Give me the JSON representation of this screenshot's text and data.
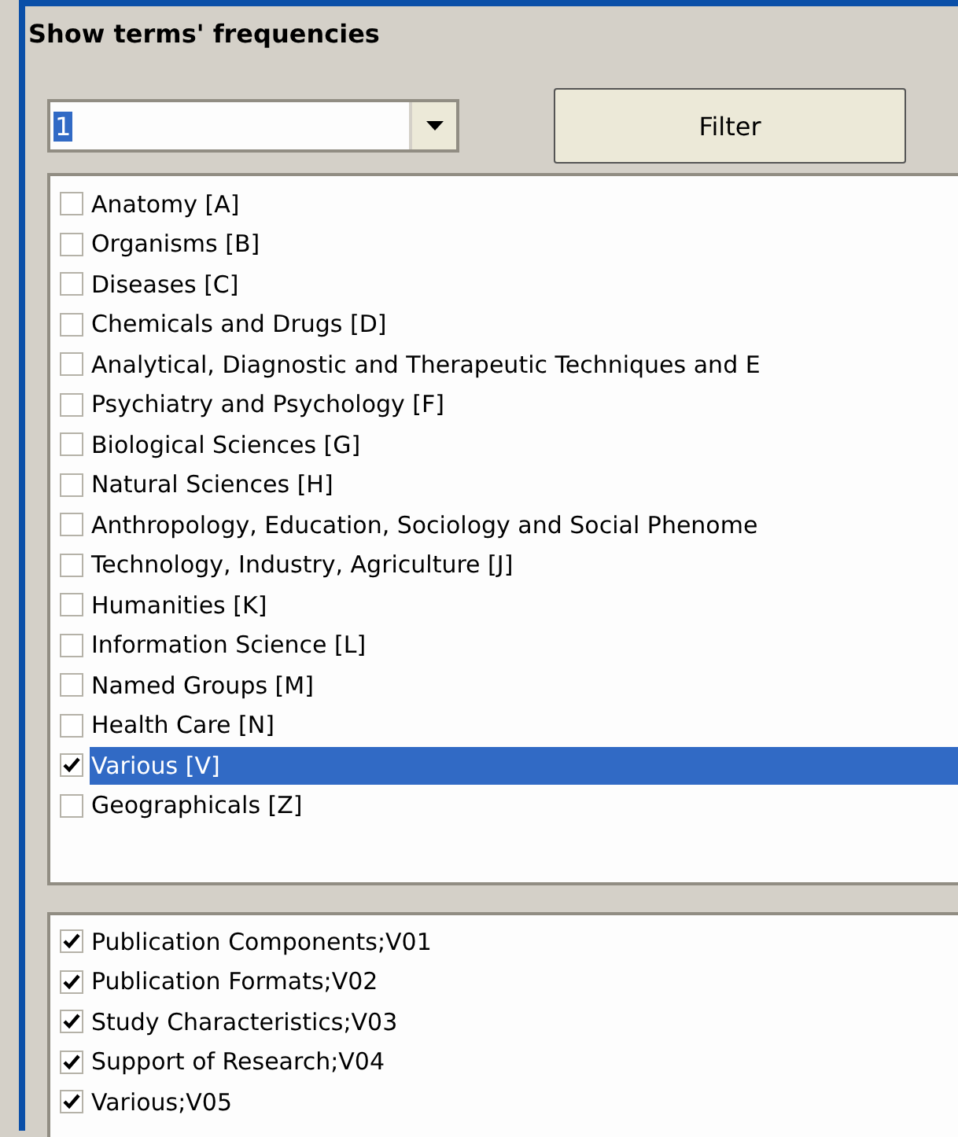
{
  "title": "Show terms' frequencies",
  "combo": {
    "value": "1"
  },
  "filter_button": "Filter",
  "categories": [
    {
      "label": "Anatomy [A]",
      "checked": false,
      "selected": false
    },
    {
      "label": "Organisms [B]",
      "checked": false,
      "selected": false
    },
    {
      "label": "Diseases [C]",
      "checked": false,
      "selected": false
    },
    {
      "label": "Chemicals and Drugs [D]",
      "checked": false,
      "selected": false
    },
    {
      "label": "Analytical, Diagnostic and Therapeutic Techniques and E",
      "checked": false,
      "selected": false
    },
    {
      "label": "Psychiatry and Psychology [F]",
      "checked": false,
      "selected": false
    },
    {
      "label": "Biological Sciences [G]",
      "checked": false,
      "selected": false
    },
    {
      "label": "Natural Sciences [H]",
      "checked": false,
      "selected": false
    },
    {
      "label": "Anthropology, Education, Sociology and Social Phenome",
      "checked": false,
      "selected": false
    },
    {
      "label": "Technology, Industry, Agriculture [J]",
      "checked": false,
      "selected": false
    },
    {
      "label": "Humanities [K]",
      "checked": false,
      "selected": false
    },
    {
      "label": "Information Science [L]",
      "checked": false,
      "selected": false
    },
    {
      "label": "Named Groups [M]",
      "checked": false,
      "selected": false
    },
    {
      "label": "Health Care [N]",
      "checked": false,
      "selected": false
    },
    {
      "label": "Various [V]",
      "checked": true,
      "selected": true
    },
    {
      "label": "Geographicals [Z]",
      "checked": false,
      "selected": false
    }
  ],
  "subcategories": [
    {
      "label": "Publication Components;V01",
      "checked": true
    },
    {
      "label": "Publication Formats;V02",
      "checked": true
    },
    {
      "label": "Study Characteristics;V03",
      "checked": true
    },
    {
      "label": "Support of Research;V04",
      "checked": true
    },
    {
      "label": "Various;V05",
      "checked": true
    }
  ]
}
